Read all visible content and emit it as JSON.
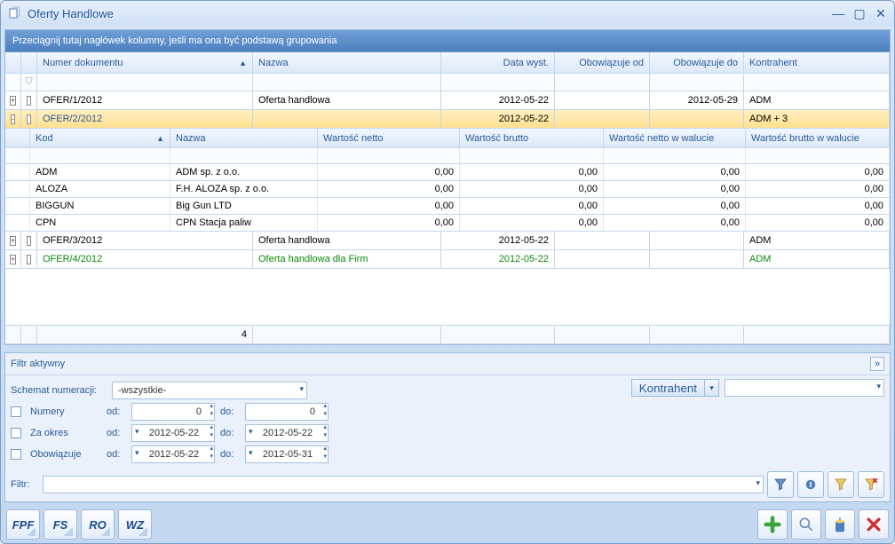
{
  "window": {
    "title": "Oferty Handlowe"
  },
  "groupPanel": {
    "hint": "Przeciągnij tutaj nagłówek kolumny, jeśli ma ona być podstawą grupowania"
  },
  "columns": {
    "numer": "Numer dokumentu",
    "nazwa": "Nazwa",
    "dataWyst": "Data wyst.",
    "obowOd": "Obowiązuje od",
    "obowDo": "Obowiązuje do",
    "kontrahent": "Kontrahent"
  },
  "rows": [
    {
      "expand": "+",
      "num": "OFER/1/2012",
      "name": "Oferta handlowa",
      "date": "2012-05-22",
      "od": "",
      "do": "2012-05-29",
      "kontr": "ADM",
      "sel": false
    },
    {
      "expand": "-",
      "num": "OFER/2/2012",
      "name": "",
      "date": "2012-05-22",
      "od": "",
      "do": "",
      "kontr": "ADM + 3",
      "sel": true
    },
    {
      "expand": "+",
      "num": "OFER/3/2012",
      "name": "Oferta handlowa",
      "date": "2012-05-22",
      "od": "",
      "do": "",
      "kontr": "ADM",
      "sel": false
    },
    {
      "expand": "+",
      "num": "OFER/4/2012",
      "name": "Oferta handlowa dla Firm",
      "date": "2012-05-22",
      "od": "",
      "do": "",
      "kontr": "ADM",
      "sel": false,
      "green": true
    }
  ],
  "subColumns": {
    "kod": "Kod",
    "nazwa": "Nazwa",
    "wn": "Wartość netto",
    "wb": "Wartość brutto",
    "wnw": "Wartość netto w walucie",
    "wbw": "Wartość brutto w walucie"
  },
  "subRows": [
    {
      "kod": "ADM",
      "nazwa": "ADM sp. z o.o.",
      "wn": "0,00",
      "wb": "0,00",
      "wnw": "0,00",
      "wbw": "0,00"
    },
    {
      "kod": "ALOZA",
      "nazwa": "F.H. ALOZA sp. z o.o.",
      "wn": "0,00",
      "wb": "0,00",
      "wnw": "0,00",
      "wbw": "0,00"
    },
    {
      "kod": "BIGGUN",
      "nazwa": "Big Gun LTD",
      "wn": "0,00",
      "wb": "0,00",
      "wnw": "0,00",
      "wbw": "0,00"
    },
    {
      "kod": "CPN",
      "nazwa": "CPN Stacja paliw",
      "wn": "0,00",
      "wb": "0,00",
      "wnw": "0,00",
      "wbw": "0,00"
    }
  ],
  "summary": {
    "count": "4"
  },
  "filter": {
    "title": "Filtr aktywny",
    "schematLabel": "Schemat numeracji:",
    "schematValue": "-wszystkie-",
    "numeryLabel": "Numery",
    "odLabel": "od:",
    "doLabel": "do:",
    "numOd": "0",
    "numDo": "0",
    "zaOkresLabel": "Za okres",
    "zaOkresOd": "2012-05-22",
    "zaOkresDo": "2012-05-22",
    "obowLabel": "Obowiązuje",
    "obowOd": "2012-05-22",
    "obowDo": "2012-05-31",
    "kontrahentBtn": "Kontrahent",
    "filtrLabel": "Filtr:"
  },
  "docButtons": [
    "FPF",
    "FS",
    "RO",
    "WZ"
  ]
}
